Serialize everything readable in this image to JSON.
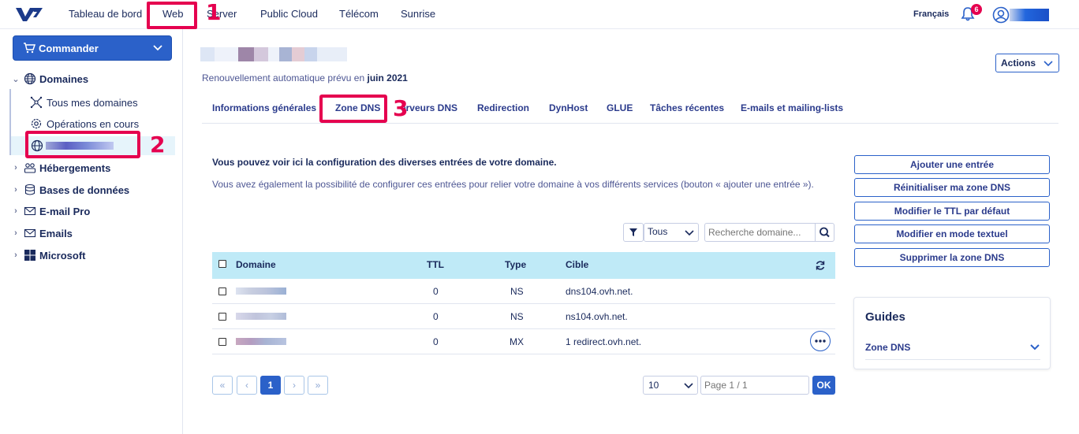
{
  "topnav": {
    "items": [
      "Tableau de bord",
      "Web",
      "Server",
      "Public Cloud",
      "Télécom",
      "Sunrise"
    ],
    "language": "Français",
    "notifications_count": "6"
  },
  "annotations": {
    "one": "1",
    "two": "2",
    "three": "3"
  },
  "sidebar": {
    "order_label": "Commander",
    "domaines": "Domaines",
    "all_domains": "Tous mes domaines",
    "operations": "Opérations en cours",
    "items": [
      "Hébergements",
      "Bases de données",
      "E-mail Pro",
      "Emails",
      "Microsoft"
    ]
  },
  "domain": {
    "renewal_text": "Renouvellement automatique prévu en",
    "renewal_date": "juin 2021",
    "actions_label": "Actions"
  },
  "tabs": [
    "Informations générales",
    "Zone DNS",
    "Serveurs DNS",
    "Redirection",
    "DynHost",
    "GLUE",
    "Tâches récentes",
    "E-mails et mailing-lists"
  ],
  "intro": {
    "title": "Vous pouvez voir ici la configuration des diverses entrées de votre domaine.",
    "text": "Vous avez également la possibilité de configurer ces entrées pour relier votre domaine à vos différents services (bouton « ajouter une entrée »)."
  },
  "side_buttons": [
    "Ajouter une entrée",
    "Réinitialiser ma zone DNS",
    "Modifier le TTL par défaut",
    "Modifier en mode textuel",
    "Supprimer la zone DNS"
  ],
  "filter": {
    "selected": "Tous",
    "search_placeholder": "Recherche domaine..."
  },
  "table": {
    "headers": {
      "domain": "Domaine",
      "ttl": "TTL",
      "type": "Type",
      "target": "Cible"
    },
    "rows": [
      {
        "ttl": "0",
        "type": "NS",
        "target": "dns104.ovh.net."
      },
      {
        "ttl": "0",
        "type": "NS",
        "target": "ns104.ovh.net."
      },
      {
        "ttl": "0",
        "type": "MX",
        "target": "1 redirect.ovh.net."
      }
    ]
  },
  "pagination": {
    "first": "«",
    "prev": "‹",
    "current": "1",
    "next": "›",
    "last": "»",
    "page_size": "10",
    "page_placeholder": "Page 1 / 1",
    "ok": "OK"
  },
  "guides": {
    "title": "Guides",
    "item": "Zone DNS"
  },
  "colors": {
    "accent": "#2b61c9",
    "highlight": "#e5004f",
    "table_header": "#bfeaf7"
  }
}
